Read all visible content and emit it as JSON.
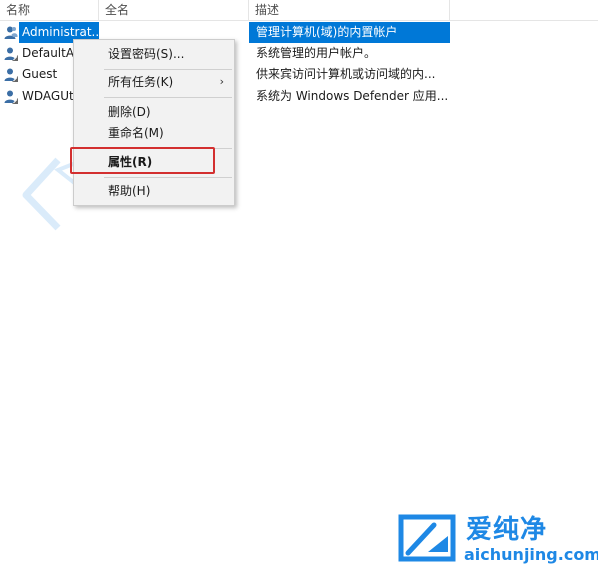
{
  "columns": {
    "name": "名称",
    "fullname": "全名",
    "description": "描述"
  },
  "rows": [
    {
      "name": "Administrat...",
      "description": "管理计算机(域)的内置帐户",
      "selected": true
    },
    {
      "name": "DefaultAc",
      "description": "系统管理的用户帐户。",
      "selected": false
    },
    {
      "name": "Guest",
      "description": "供来宾访问计算机或访问域的内...",
      "selected": false
    },
    {
      "name": "WDAGUt",
      "description": "系统为 Windows Defender 应用...",
      "selected": false
    }
  ],
  "context_menu": {
    "set_password": "设置密码(S)...",
    "all_tasks": "所有任务(K)",
    "all_tasks_arrow": "›",
    "delete": "删除(D)",
    "rename": "重命名(M)",
    "properties": "属性(R)",
    "help": "帮助(H)"
  },
  "watermark": {
    "brand_name": "爱纯净",
    "brand_url": "aichunjing.com",
    "logo_icon": "aichunjing-logo-icon"
  },
  "colors": {
    "selection": "#0078d7",
    "highlight_box": "#d32f2f",
    "brand": "#1e88e5"
  }
}
